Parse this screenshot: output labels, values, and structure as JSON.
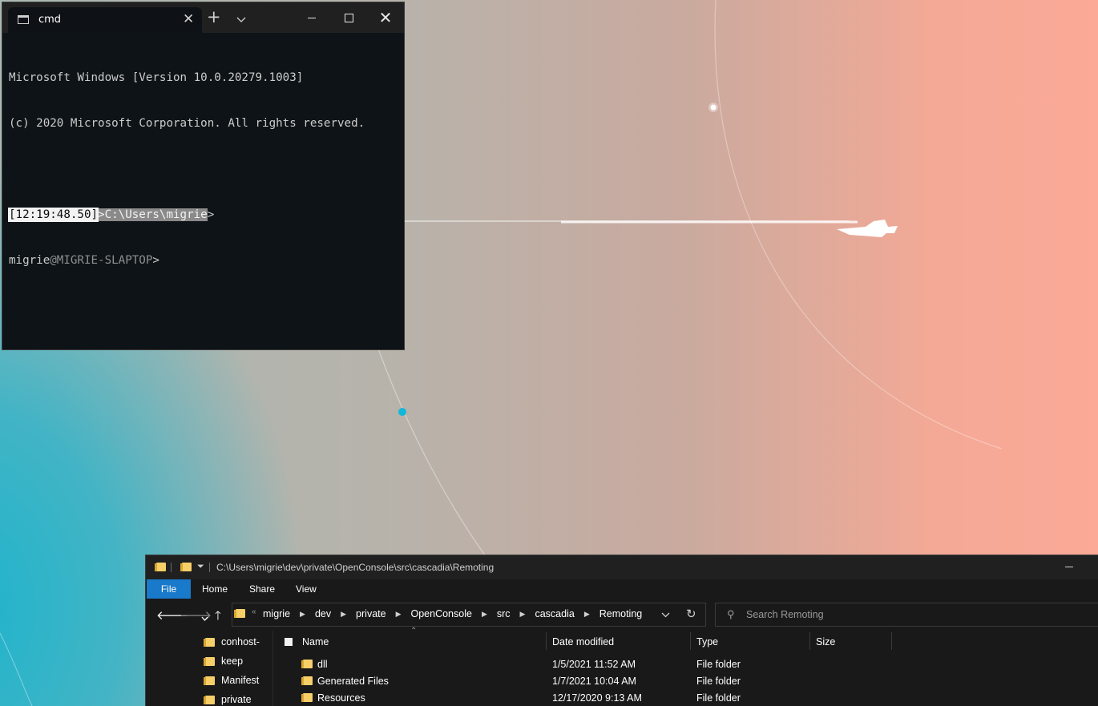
{
  "terminal": {
    "tab_title": "cmd",
    "lines": {
      "line1": "Microsoft Windows [Version 10.0.20279.1003]",
      "line2": "(c) 2020 Microsoft Corporation. All rights reserved."
    },
    "prompt": {
      "time": "[12:19:48.50]",
      "path": ">C:\\Users\\migrie",
      "suffix": ">",
      "user": "migrie",
      "host": "@MIGRIE-SLAPTOP",
      "end": ">"
    }
  },
  "explorer": {
    "title_path": "C:\\Users\\migrie\\dev\\private\\OpenConsole\\src\\cascadia\\Remoting",
    "ribbon": {
      "file": "File",
      "home": "Home",
      "share": "Share",
      "view": "View"
    },
    "breadcrumbs": [
      "migrie",
      "dev",
      "private",
      "OpenConsole",
      "src",
      "cascadia",
      "Remoting"
    ],
    "search_placeholder": "Search Remoting",
    "tree_items": [
      "conhost-",
      "keep",
      "Manifest",
      "private"
    ],
    "columns": {
      "name": "Name",
      "date": "Date modified",
      "type": "Type",
      "size": "Size"
    },
    "files": [
      {
        "name": "dll",
        "date": "1/5/2021 11:52 AM",
        "type": "File folder"
      },
      {
        "name": "Generated Files",
        "date": "1/7/2021 10:04 AM",
        "type": "File folder"
      },
      {
        "name": "Resources",
        "date": "12/17/2020 9:13 AM",
        "type": "File folder"
      }
    ]
  },
  "colors": {
    "accent": "#1979ca",
    "terminal_bg": "#0e1317",
    "folder": "#f7cf68",
    "wallpaper_peach": "#fca997",
    "wallpaper_teal": "#1fb3cc"
  }
}
